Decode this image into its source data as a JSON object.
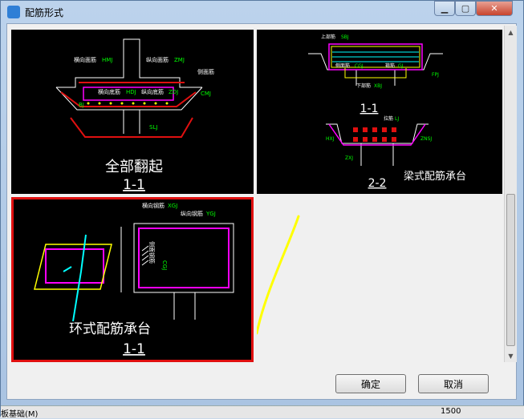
{
  "window": {
    "title": "配筋形式",
    "minimize_glyph": "▁",
    "maximize_glyph": "▢",
    "close_glyph": "✕"
  },
  "options": [
    {
      "caption": "全部翻起",
      "section": "1-1",
      "labels": {
        "hxmj": "横向面筋",
        "zxmj": "纵向面筋",
        "hxdj": "横向底筋",
        "zxdj": "纵向底筋",
        "side": "侧面筋",
        "hmj": "HMJ",
        "zmj": "ZMJ",
        "hdj": "HDJ",
        "zdj": "ZDJ",
        "cmj": "CMJ",
        "bj": "BJ",
        "slj": "SLJ"
      }
    },
    {
      "caption": "梁式配筋承台",
      "section_top": "1-1",
      "section_bottom": "2-2",
      "labels": {
        "top": "上部筋",
        "ssj": "SBJ",
        "side": "侧面筋",
        "cgj": "CGJ",
        "hoop": "箍筋",
        "gj": "GJ",
        "bottom": "下部筋",
        "xbj": "XBJ",
        "lj": "拉筋",
        "ljcode": "LJ",
        "fpj": "FPJ",
        "hxj": "HXJ",
        "znsj": "ZNSJ",
        "zxj": "ZXJ"
      }
    },
    {
      "caption": "环式配筋承台",
      "section": "1-1",
      "labels": {
        "hxgj": "横向钢筋",
        "xgj": "XGJ",
        "zxgj": "纵向钢筋",
        "ygj": "YGJ",
        "cg": "侧面钢筋",
        "cgj": "CGJ"
      }
    }
  ],
  "buttons": {
    "ok": "确定",
    "cancel": "取消"
  },
  "scrollbar": {
    "up": "▲",
    "down": "▼"
  },
  "background": {
    "left_text": "板基础(M)",
    "right_num": "1500"
  },
  "colors": {
    "selected_border": "#e01010",
    "annotation": "#ffff00"
  }
}
